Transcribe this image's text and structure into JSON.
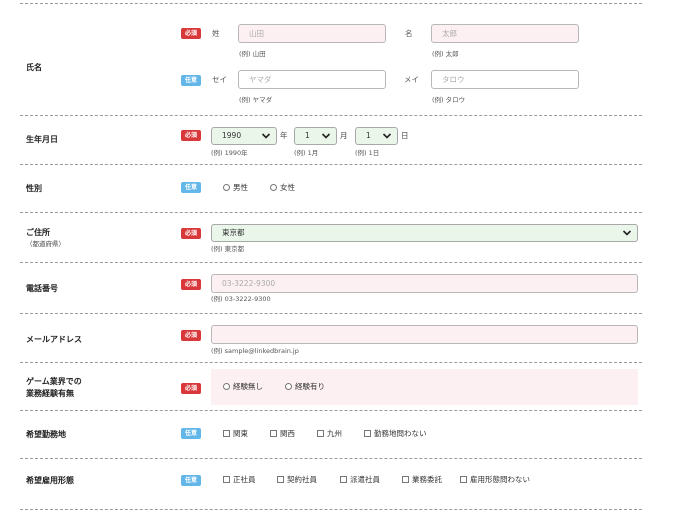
{
  "badges": {
    "required": "必須",
    "optional": "任意"
  },
  "name": {
    "label": "氏名",
    "sei_label": "姓",
    "sei_placeholder": "山田",
    "sei_hint": "(例) 山田",
    "mei_label": "名",
    "mei_placeholder": "太郎",
    "mei_hint": "(例) 太郎",
    "sei_kana_label": "セイ",
    "sei_kana_placeholder": "ヤマダ",
    "sei_kana_hint": "(例) ヤマダ",
    "mei_kana_label": "メイ",
    "mei_kana_placeholder": "タロウ",
    "mei_kana_hint": "(例) タロウ"
  },
  "birth": {
    "label": "生年月日",
    "year_value": "1990",
    "year_unit": "年",
    "year_hint": "(例) 1990年",
    "month_value": "1",
    "month_unit": "月",
    "month_hint": "(例) 1月",
    "day_value": "1",
    "day_unit": "日",
    "day_hint": "(例) 1日"
  },
  "gender": {
    "label": "性別",
    "options": [
      "男性",
      "女性"
    ]
  },
  "address": {
    "label": "ご住所",
    "sublabel": "（都道府県）",
    "value": "東京都",
    "hint": "(例) 東京都"
  },
  "phone": {
    "label": "電話番号",
    "placeholder": "03-3222-9300",
    "hint": "(例) 03-3222-9300"
  },
  "email": {
    "label": "メールアドレス",
    "placeholder": "",
    "hint": "(例) sample@linkedbrain.jp"
  },
  "experience": {
    "label_line1": "ゲーム業界での",
    "label_line2": "業務経験有無",
    "options": [
      "経験無し",
      "経験有り"
    ]
  },
  "location": {
    "label": "希望勤務地",
    "options": [
      "関東",
      "関西",
      "九州",
      "勤務地問わない"
    ]
  },
  "employment": {
    "label": "希望雇用形態",
    "options": [
      "正社員",
      "契約社員",
      "派遣社員",
      "業務委託",
      "雇用形態問わない"
    ]
  }
}
